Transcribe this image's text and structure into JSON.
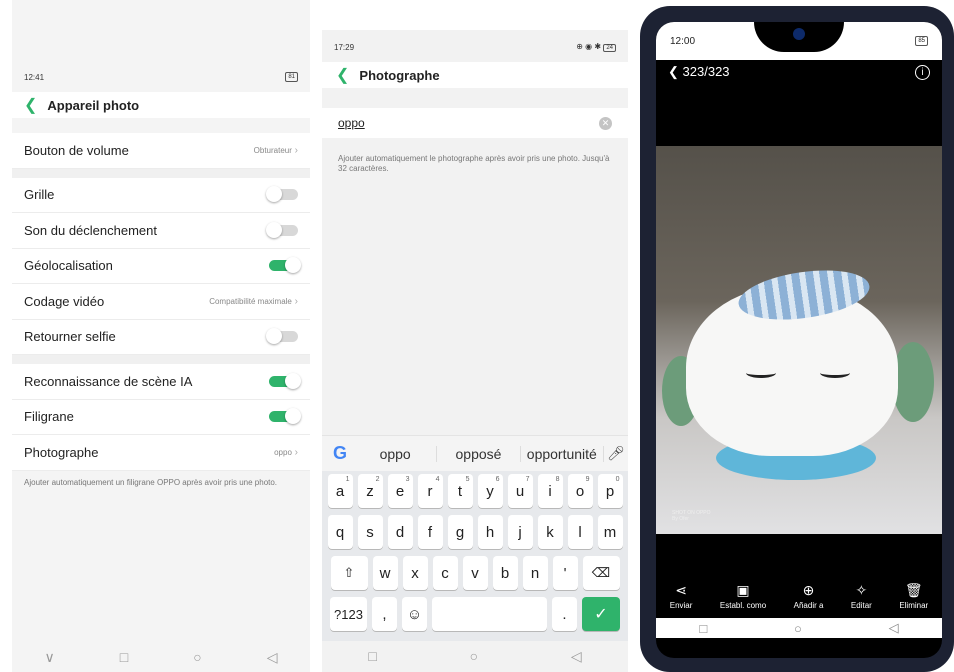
{
  "left_screen": {
    "status_time": "12:41",
    "battery": "81",
    "title": "Appareil photo",
    "rows": [
      {
        "label": "Bouton de volume",
        "value": "Obturateur"
      },
      {
        "label": "Grille",
        "toggle": "off"
      },
      {
        "label": "Son du déclenchement",
        "toggle": "off"
      },
      {
        "label": "Géolocalisation",
        "toggle": "on"
      },
      {
        "label": "Codage vidéo",
        "value": "Compatibilité maximale"
      },
      {
        "label": "Retourner selfie",
        "toggle": "off"
      },
      {
        "label": "Reconnaissance de scène IA",
        "toggle": "on"
      },
      {
        "label": "Filigrane",
        "toggle": "on"
      },
      {
        "label": "Photographe",
        "value": "oppo"
      }
    ],
    "note": "Ajouter automatiquement un filigrane OPPO après avoir pris une photo.",
    "nav": [
      "∨",
      "□",
      "○",
      "◁"
    ]
  },
  "middle_screen": {
    "status_time": "17:29",
    "status_icons": "⊕ ◉ ✱",
    "battery": "24",
    "title": "Photographe",
    "input_value": "oppo",
    "note": "Ajouter automatiquement le photographe après avoir pris une photo. Jusqu'à 32 caractères.",
    "suggestions": [
      "oppo",
      "opposé",
      "opportunité"
    ],
    "keyboard": {
      "row1": [
        {
          "k": "a",
          "n": "1"
        },
        {
          "k": "z",
          "n": "2"
        },
        {
          "k": "e",
          "n": "3"
        },
        {
          "k": "r",
          "n": "4"
        },
        {
          "k": "t",
          "n": "5"
        },
        {
          "k": "y",
          "n": "6"
        },
        {
          "k": "u",
          "n": "7"
        },
        {
          "k": "i",
          "n": "8"
        },
        {
          "k": "o",
          "n": "9"
        },
        {
          "k": "p",
          "n": "0"
        }
      ],
      "row2": [
        "q",
        "s",
        "d",
        "f",
        "g",
        "h",
        "j",
        "k",
        "l",
        "m"
      ],
      "row3": [
        "w",
        "x",
        "c",
        "v",
        "b",
        "n",
        "'"
      ],
      "sym_label": "?123",
      "comma": ",",
      "period": "."
    },
    "nav": [
      "□",
      "○",
      "◁"
    ]
  },
  "right_screen": {
    "status_time": "12:00",
    "battery": "85",
    "counter": "323/323",
    "watermark": "SHOT ON OPPO",
    "watermark_by": "By Ofer",
    "tools": [
      {
        "label": "Enviar",
        "icon": "share-icon"
      },
      {
        "label": "Establ. como",
        "icon": "image-set-icon"
      },
      {
        "label": "Añadir a",
        "icon": "add-circle-icon"
      },
      {
        "label": "Editar",
        "icon": "magic-wand-icon"
      },
      {
        "label": "Eliminar",
        "icon": "trash-icon"
      }
    ],
    "nav": [
      "□",
      "○",
      "◁"
    ]
  },
  "colors": {
    "accent_green": "#2fb36b",
    "toggle_off": "#d8d8d8",
    "phone_frame": "#1d2233"
  }
}
